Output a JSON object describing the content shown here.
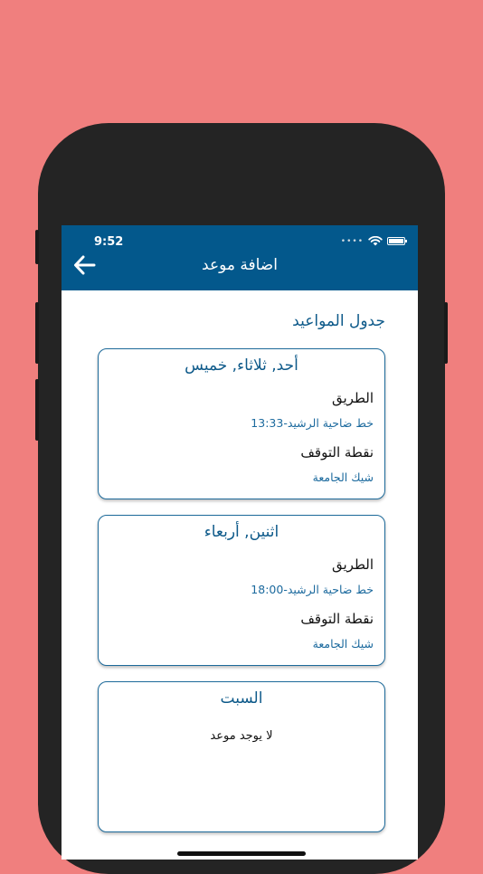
{
  "status": {
    "time": "9:52"
  },
  "header": {
    "title": "اضافة موعد"
  },
  "section": {
    "title": "جدول المواعيد"
  },
  "schedules": [
    {
      "days": "أحد, ثلاثاء, خميس",
      "route_label": "الطريق",
      "route_value": "خط ضاحية الرشيد-13:33",
      "stop_label": "نقطة التوقف",
      "stop_value": "شيك الجامعة"
    },
    {
      "days": "اثنين, أربعاء",
      "route_label": "الطريق",
      "route_value": "خط ضاحية الرشيد-18:00",
      "stop_label": "نقطة التوقف",
      "stop_value": "شيك الجامعة"
    },
    {
      "days": "السبت",
      "empty_text": "لا يوجد موعد"
    }
  ],
  "icons": {
    "back": "arrow-left-icon",
    "wifi": "wifi-icon",
    "battery": "battery-icon"
  },
  "colors": {
    "background": "#f07f7e",
    "appbar": "#03588c",
    "accent_text": "#0e5a8a"
  }
}
